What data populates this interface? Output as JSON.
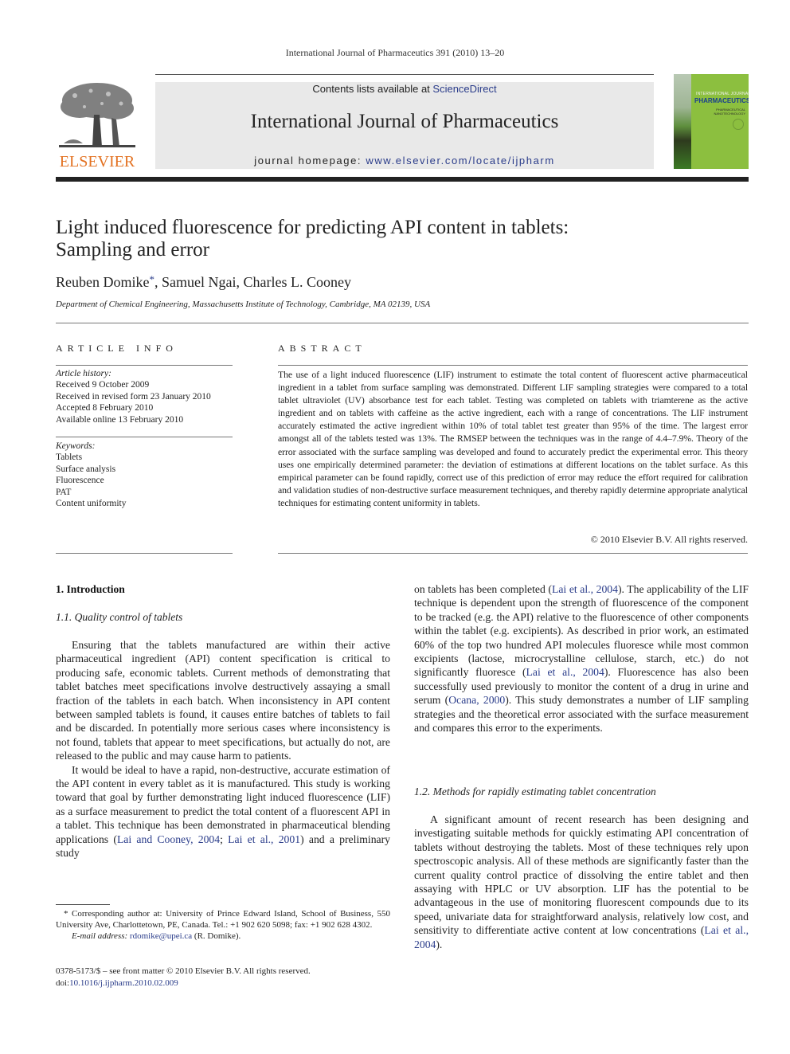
{
  "running_head": "International Journal of Pharmaceutics 391 (2010) 13–20",
  "masthead": {
    "publisher_logo_text": "ELSEVIER",
    "contents_prefix": "Contents lists available at ",
    "contents_link": "ScienceDirect",
    "journal_title": "International Journal of Pharmaceutics",
    "homepage_prefix": "journal homepage: ",
    "homepage_url": "www.elsevier.com/locate/ijpharm",
    "cover": {
      "line1": "INTERNATIONAL JOURNAL OF",
      "line2": "PHARMACEUTICS",
      "line3a": "PHARMACEUTICAL",
      "line3b": "NANOTECHNOLOGY"
    },
    "colors": {
      "logo_orange": "#e37222",
      "link_blue": "#2a3c8a",
      "cover_green": "#8cbf3f",
      "masthead_gray": "#e9e9e9"
    }
  },
  "article": {
    "title_line1": "Light induced fluorescence for predicting API content in tablets:",
    "title_line2": "Sampling and error",
    "authors": [
      {
        "name": "Reuben Domike",
        "mark": "*"
      },
      {
        "name": "Samuel Ngai"
      },
      {
        "name": "Charles L. Cooney"
      }
    ],
    "author_sep": ", ",
    "affiliation": "Department of Chemical Engineering, Massachusetts Institute of Technology, Cambridge, MA 02139, USA"
  },
  "article_info": {
    "heading": "ARTICLE INFO",
    "history_label": "Article history:",
    "history": [
      "Received 9 October 2009",
      "Received in revised form 23 January 2010",
      "Accepted 8 February 2010",
      "Available online 13 February 2010"
    ],
    "keywords_label": "Keywords:",
    "keywords": [
      "Tablets",
      "Surface analysis",
      "Fluorescence",
      "PAT",
      "Content uniformity"
    ]
  },
  "abstract": {
    "heading": "ABSTRACT",
    "text": "The use of a light induced fluorescence (LIF) instrument to estimate the total content of fluorescent active pharmaceutical ingredient in a tablet from surface sampling was demonstrated. Different LIF sampling strategies were compared to a total tablet ultraviolet (UV) absorbance test for each tablet. Testing was completed on tablets with triamterene as the active ingredient and on tablets with caffeine as the active ingredient, each with a range of concentrations. The LIF instrument accurately estimated the active ingredient within 10% of total tablet test greater than 95% of the time. The largest error amongst all of the tablets tested was 13%. The RMSEP between the techniques was in the range of 4.4–7.9%. Theory of the error associated with the surface sampling was developed and found to accurately predict the experimental error. This theory uses one empirically determined parameter: the deviation of estimations at different locations on the tablet surface. As this empirical parameter can be found rapidly, correct use of this prediction of error may reduce the effort required for calibration and validation studies of non-destructive surface measurement techniques, and thereby rapidly determine appropriate analytical techniques for estimating content uniformity in tablets.",
    "copyright": "© 2010 Elsevier B.V. All rights reserved."
  },
  "body": {
    "section1_heading": "1.  Introduction",
    "section1_1_heading": "1.1.  Quality control of tablets",
    "p1": "Ensuring that the tablets manufactured are within their active pharmaceutical ingredient (API) content specification is critical to producing safe, economic tablets. Current methods of demonstrating that tablet batches meet specifications involve destructively assaying a small fraction of the tablets in each batch. When inconsistency in API content between sampled tablets is found, it causes entire batches of tablets to fail and be discarded. In potentially more serious cases where inconsistency is not found, tablets that appear to meet specifications, but actually do not, are released to the public and may cause harm to patients.",
    "p2_a": "It would be ideal to have a rapid, non-destructive, accurate estimation of the API content in every tablet as it is manufactured. This study is working toward that goal by further demonstrating light induced fluorescence (LIF) as a surface measurement to predict the total content of a fluorescent API in a tablet. This technique has been demonstrated in pharmaceutical blending applications (",
    "p2_ref1": "Lai and Cooney, 2004",
    "p2_sep": "; ",
    "p2_ref2": "Lai et al., 2001",
    "p2_b": ") and a preliminary study",
    "p3_a": "on tablets has been completed (",
    "p3_ref1": "Lai et al., 2004",
    "p3_b": "). The applicability of the LIF technique is dependent upon the strength of fluorescence of the component to be tracked (e.g. the API) relative to the fluorescence of other components within the tablet (e.g. excipients). As described in prior work, an estimated 60% of the top two hundred API molecules fluoresce while most common excipients (lactose, microcrystalline cellulose, starch, etc.) do not significantly fluoresce (",
    "p3_ref2": "Lai et al., 2004",
    "p3_c": "). Fluorescence has also been successfully used previously to monitor the content of a drug in urine and serum (",
    "p3_ref3": "Ocana, 2000",
    "p3_d": "). This study demonstrates a number of LIF sampling strategies and the theoretical error associated with the surface measurement and compares this error to the experiments.",
    "section1_2_heading": "1.2.  Methods for rapidly estimating tablet concentration",
    "p4_a": "A significant amount of recent research has been designing and investigating suitable methods for quickly estimating API concentration of tablets without destroying the tablets. Most of these techniques rely upon spectroscopic analysis. All of these methods are significantly faster than the current quality control practice of dissolving the entire tablet and then assaying with HPLC or UV absorption. LIF has the potential to be advantageous in the use of monitoring fluorescent compounds due to its speed, univariate data for straightforward analysis, relatively low cost, and sensitivity to differentiate active content at low concentrations (",
    "p4_ref": "Lai et al., 2004",
    "p4_b": ")."
  },
  "footnote": {
    "mark": "*",
    "text": " Corresponding author at: University of Prince Edward Island, School of Business, 550 University Ave, Charlottetown, PE, Canada. Tel.: +1 902 620 5098; fax: +1 902 628 4302.",
    "email_label": "E-mail address: ",
    "email": "rdomike@upei.ca",
    "email_suffix": " (R. Domike)."
  },
  "front_matter": {
    "issn_line": "0378-5173/$ – see front matter © 2010 Elsevier B.V. All rights reserved.",
    "doi_label": "doi:",
    "doi": "10.1016/j.ijpharm.2010.02.009"
  }
}
